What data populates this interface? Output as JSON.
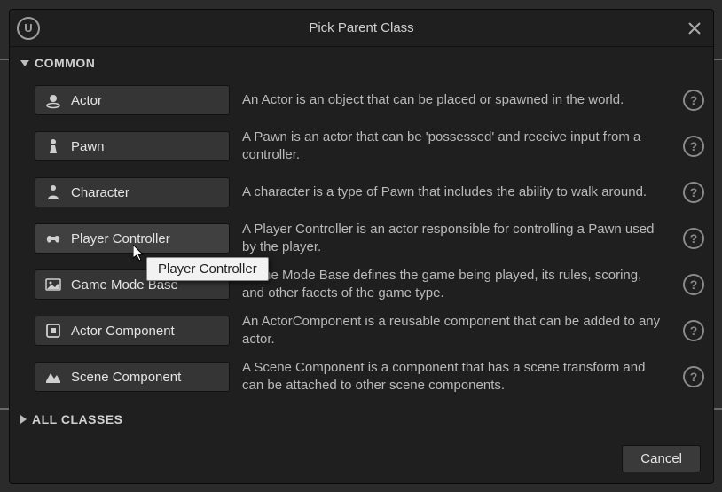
{
  "title": "Pick Parent Class",
  "sections": {
    "common": "COMMON",
    "all": "ALL CLASSES"
  },
  "classes": [
    {
      "label": "Actor",
      "desc": "An Actor is an object that can be placed or spawned in the world."
    },
    {
      "label": "Pawn",
      "desc": "A Pawn is an actor that can be 'possessed' and receive input from a controller."
    },
    {
      "label": "Character",
      "desc": "A character is a type of Pawn that includes the ability to walk around."
    },
    {
      "label": "Player Controller",
      "desc": "A Player Controller is an actor responsible for controlling a Pawn used by the player."
    },
    {
      "label": "Game Mode Base",
      "desc": "Game Mode Base defines the game being played, its rules, scoring, and other facets of the game type."
    },
    {
      "label": "Actor Component",
      "desc": "An ActorComponent is a reusable component that can be added to any actor."
    },
    {
      "label": "Scene Component",
      "desc": "A Scene Component is a component that has a scene transform and can be attached to other scene components."
    }
  ],
  "buttons": {
    "cancel": "Cancel"
  },
  "tooltip": "Player Controller",
  "logo_letter": "U",
  "help_glyph": "?"
}
